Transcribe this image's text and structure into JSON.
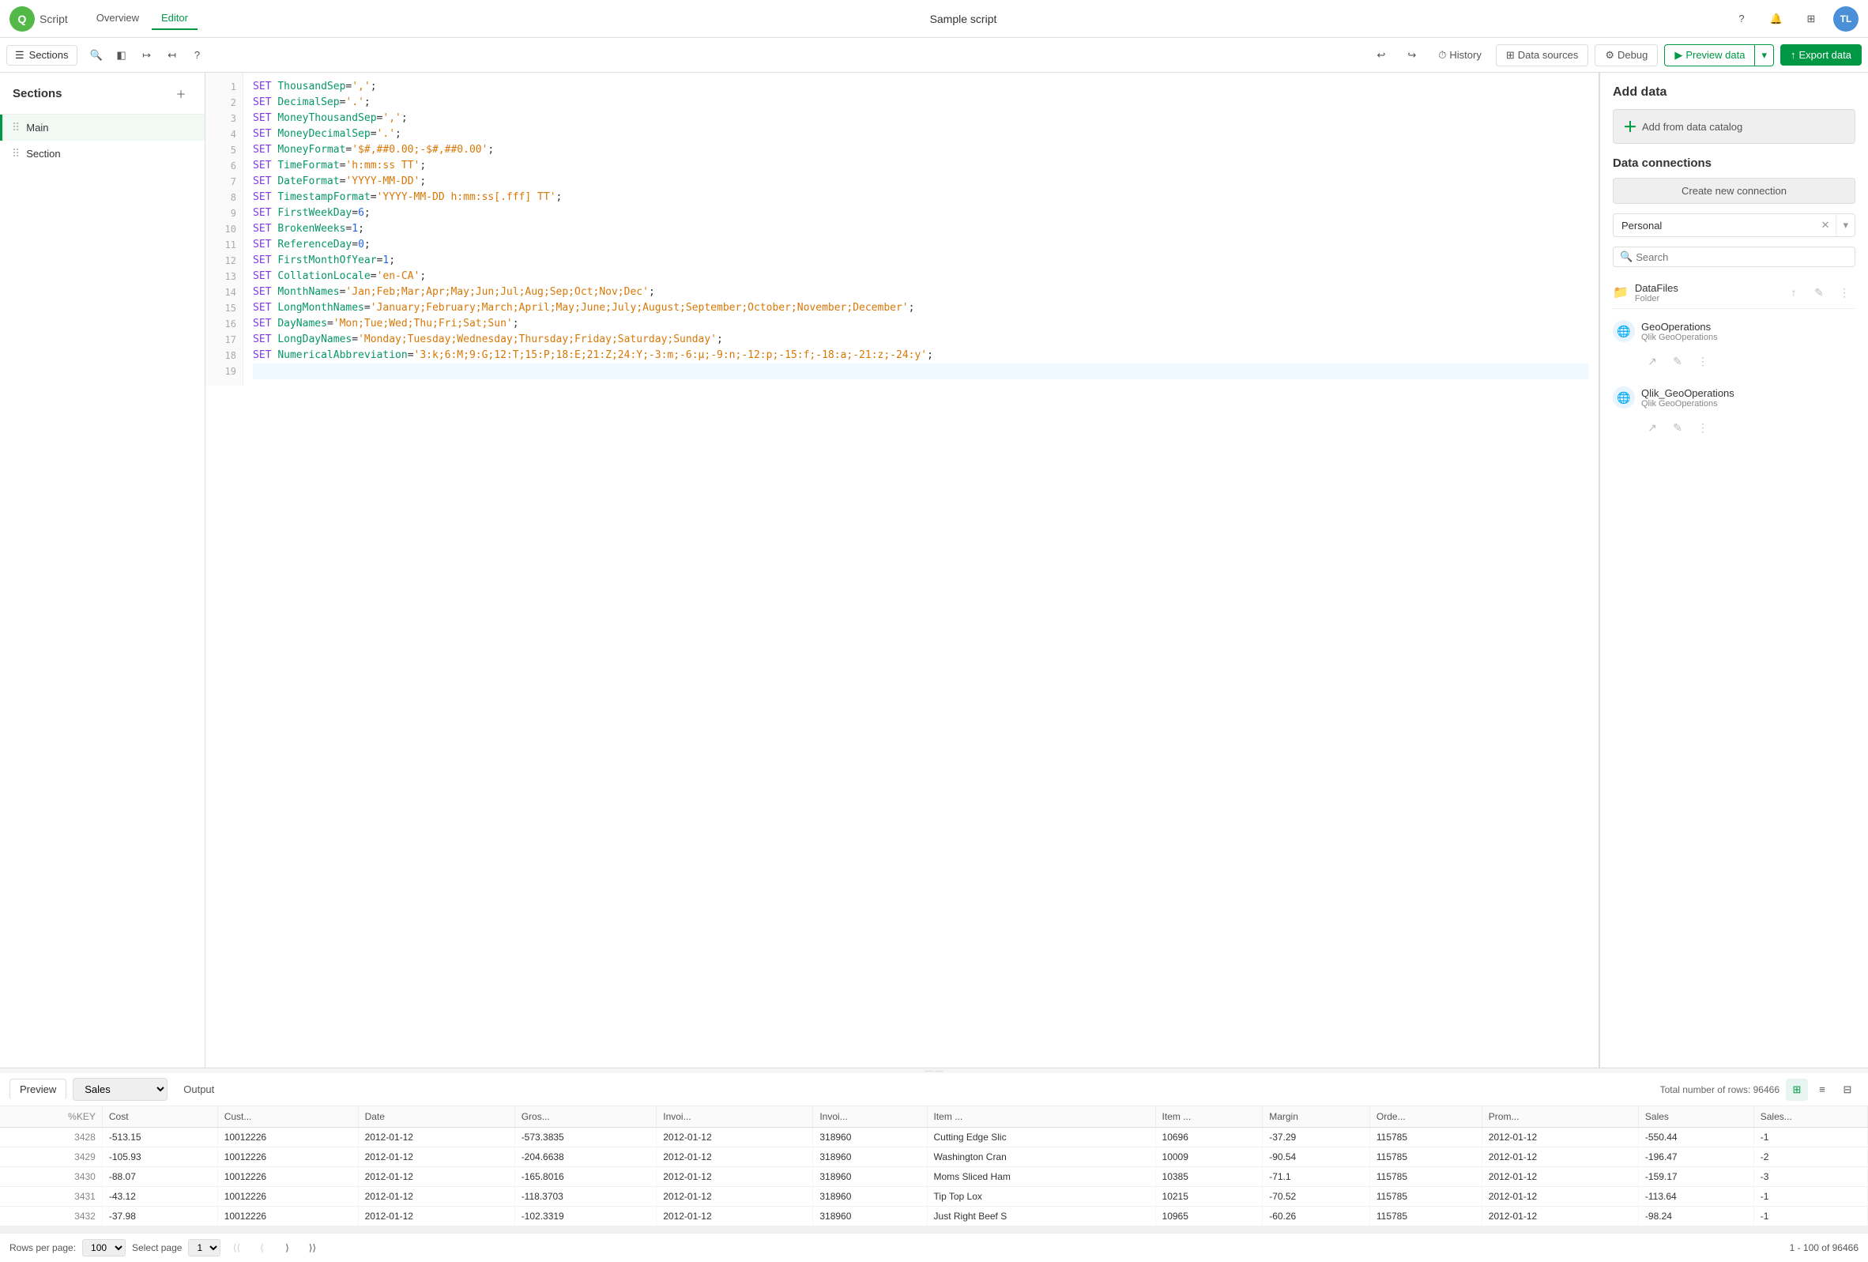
{
  "app": {
    "name": "Script",
    "title": "Sample script"
  },
  "nav": {
    "logo_letter": "Q",
    "links": [
      {
        "label": "Overview",
        "active": false
      },
      {
        "label": "Editor",
        "active": true
      }
    ],
    "icons": {
      "help": "?",
      "bell": "🔔",
      "grid": "⊞",
      "avatar": "TL"
    }
  },
  "toolbar": {
    "sections_label": "Sections",
    "history_label": "History",
    "data_sources_label": "Data sources",
    "debug_label": "Debug",
    "preview_label": "Preview data",
    "export_label": "Export data"
  },
  "sidebar": {
    "title": "Sections",
    "items": [
      {
        "label": "Main",
        "active": true
      },
      {
        "label": "Section",
        "active": false
      }
    ]
  },
  "editor": {
    "lines": [
      {
        "num": 1,
        "code": "SET ThousandSep=',';",
        "type": "set"
      },
      {
        "num": 2,
        "code": "SET DecimalSep='.';",
        "type": "set"
      },
      {
        "num": 3,
        "code": "SET MoneyThousandSep=',';",
        "type": "set"
      },
      {
        "num": 4,
        "code": "SET MoneyDecimalSep='.';",
        "type": "set"
      },
      {
        "num": 5,
        "code": "SET MoneyFormat='$#,##0.00;-$#,##0.00';",
        "type": "set"
      },
      {
        "num": 6,
        "code": "SET TimeFormat='h:mm:ss TT';",
        "type": "set"
      },
      {
        "num": 7,
        "code": "SET DateFormat='YYYY-MM-DD';",
        "type": "set"
      },
      {
        "num": 8,
        "code": "SET TimestampFormat='YYYY-MM-DD h:mm:ss[.fff] TT';",
        "type": "set"
      },
      {
        "num": 9,
        "code": "SET FirstWeekDay=6;",
        "type": "set"
      },
      {
        "num": 10,
        "code": "SET BrokenWeeks=1;",
        "type": "set"
      },
      {
        "num": 11,
        "code": "SET ReferenceDay=0;",
        "type": "set"
      },
      {
        "num": 12,
        "code": "SET FirstMonthOfYear=1;",
        "type": "set"
      },
      {
        "num": 13,
        "code": "SET CollationLocale='en-CA';",
        "type": "set"
      },
      {
        "num": 14,
        "code": "SET MonthNames='Jan;Feb;Mar;Apr;May;Jun;Jul;Aug;Sep;Oct;Nov;Dec';",
        "type": "set"
      },
      {
        "num": 15,
        "code": "SET LongMonthNames='January;February;March;April;May;June;July;August;September;October;November;December';",
        "type": "set"
      },
      {
        "num": 16,
        "code": "SET DayNames='Mon;Tue;Wed;Thu;Fri;Sat;Sun';",
        "type": "set"
      },
      {
        "num": 17,
        "code": "SET LongDayNames='Monday;Tuesday;Wednesday;Thursday;Friday;Saturday;Sunday';",
        "type": "set"
      },
      {
        "num": 18,
        "code": "SET NumericalAbbreviation='3:k;6:M;9:G;12:T;15:P;18:E;21:Z;24:Y;-3:m;-6:μ;-9:n;-12:p;-15:f;-18:a;-21:z;-24:y';",
        "type": "set"
      },
      {
        "num": 19,
        "code": "",
        "type": "blank"
      }
    ]
  },
  "right_panel": {
    "add_data_title": "Add data",
    "add_catalog_label": "Add from data catalog",
    "connections_title": "Data connections",
    "create_connection_label": "Create new connection",
    "search_placeholder": "Search",
    "filter_value": "Personal",
    "folder_label": "DataFiles",
    "folder_sub": "Folder",
    "connections": [
      {
        "name": "GeoOperations",
        "sub": "Qlik GeoOperations"
      },
      {
        "name": "Qlik_GeoOperations",
        "sub": "Qlik GeoOperations"
      }
    ]
  },
  "bottom_panel": {
    "preview_label": "Preview",
    "table_name": "Sales",
    "output_label": "Output",
    "total_rows_label": "Total number of rows: 96466",
    "table_headers": [
      "%KEY",
      "Cost",
      "Cust...",
      "Date",
      "Gros...",
      "Invoi...",
      "Invoi...",
      "Item ...",
      "Item ...",
      "Margin",
      "Orde...",
      "Prom...",
      "Sales",
      "Sales..."
    ],
    "table_rows": [
      [
        3428,
        -513.15,
        10012226,
        "2012-01-12",
        -573.3835,
        "2012-01-12",
        318960,
        "Cutting Edge Slic",
        10696,
        -37.29,
        115785,
        "2012-01-12",
        -550.44,
        -1
      ],
      [
        3429,
        -105.93,
        10012226,
        "2012-01-12",
        -204.6638,
        "2012-01-12",
        318960,
        "Washington Cran",
        10009,
        -90.54,
        115785,
        "2012-01-12",
        -196.47,
        -2
      ],
      [
        3430,
        -88.07,
        10012226,
        "2012-01-12",
        -165.8016,
        "2012-01-12",
        318960,
        "Moms Sliced Ham",
        10385,
        -71.1,
        115785,
        "2012-01-12",
        -159.17,
        -3
      ],
      [
        3431,
        -43.12,
        10012226,
        "2012-01-12",
        -118.3703,
        "2012-01-12",
        318960,
        "Tip Top Lox",
        10215,
        -70.52,
        115785,
        "2012-01-12",
        -113.64,
        -1
      ],
      [
        3432,
        -37.98,
        10012226,
        "2012-01-12",
        -102.3319,
        "2012-01-12",
        318960,
        "Just Right Beef S",
        10965,
        -60.26,
        115785,
        "2012-01-12",
        -98.24,
        -1
      ]
    ],
    "pagination": {
      "rows_per_page_label": "Rows per page:",
      "rows_per_page_value": "100",
      "select_page_label": "Select page",
      "page_value": "1",
      "range_label": "1 - 100 of 96466"
    }
  }
}
